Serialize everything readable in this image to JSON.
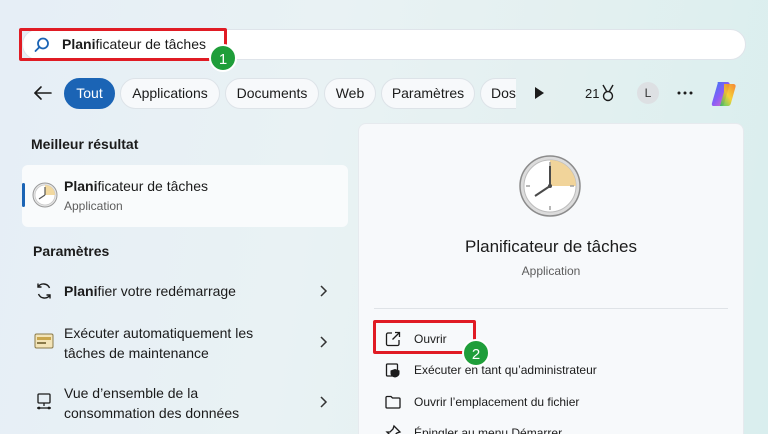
{
  "search": {
    "query_bold": "Plani",
    "query_rest": "ficateur de tâches"
  },
  "markers": [
    "1",
    "2"
  ],
  "filters": {
    "tabs": [
      {
        "label": "Tout",
        "active": true
      },
      {
        "label": "Applications",
        "active": false
      },
      {
        "label": "Documents",
        "active": false
      },
      {
        "label": "Web",
        "active": false
      },
      {
        "label": "Paramètres",
        "active": false
      },
      {
        "label": "Dos",
        "active": false
      }
    ],
    "points": "21",
    "avatar_initial": "L"
  },
  "left": {
    "best_heading": "Meilleur résultat",
    "best": {
      "title_bold": "Plani",
      "title_rest": "ficateur de tâches",
      "subtitle": "Application"
    },
    "settings_heading": "Paramètres",
    "settings": [
      {
        "bold": "Plani",
        "rest": "fier votre redémarrage",
        "line2": ""
      },
      {
        "bold": "",
        "rest": "Exécuter automatiquement les",
        "line2": "tâches de maintenance"
      },
      {
        "bold": "",
        "rest": "Vue d’ensemble de la",
        "line2": "consommation des données"
      }
    ]
  },
  "right": {
    "app_title": "Planificateur de tâches",
    "app_subtitle": "Application",
    "actions": [
      "Ouvrir",
      "Exécuter en tant qu’administrateur",
      "Ouvrir l’emplacement du fichier",
      "Épingler au menu Démarrer"
    ]
  },
  "colors": {
    "accent": "#1b64b5",
    "highlight_box": "#e01b24",
    "marker": "#1f9e3a"
  }
}
